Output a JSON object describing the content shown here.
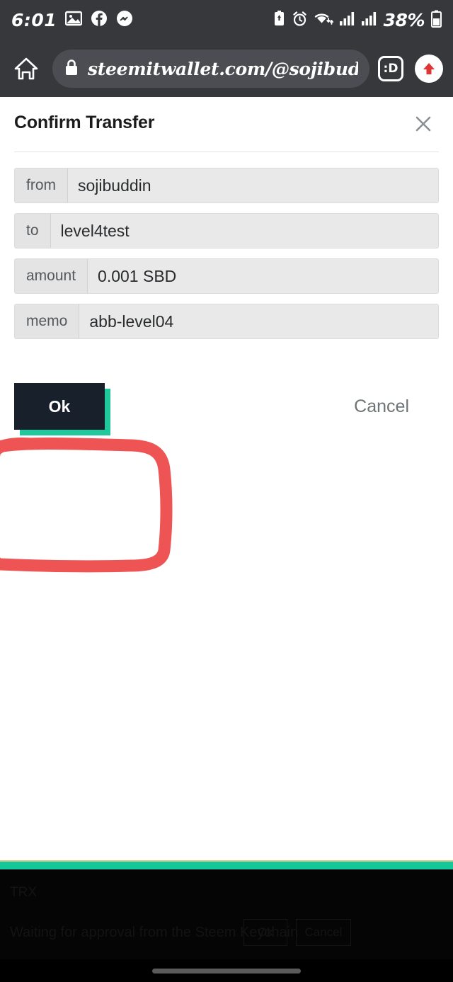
{
  "status_bar": {
    "time": "6:01",
    "battery_percent": "38%",
    "left_icons": [
      "photo-icon",
      "facebook-icon",
      "messenger-icon"
    ],
    "right_icons": [
      "battery-saver-icon",
      "alarm-icon",
      "wifi-icon",
      "signal-1-icon",
      "signal-2-icon",
      "battery-icon"
    ],
    "bar_color": "#36383c"
  },
  "browser": {
    "home_icon": "home-icon",
    "lock_icon": "lock-icon",
    "url": "steemitwallet.com/@sojibuddi",
    "tab_count_label": ":D",
    "menu_icon": "upload-arrow-icon",
    "bar_color": "#36383c"
  },
  "dialog": {
    "title": "Confirm Transfer",
    "close_icon": "close-icon",
    "fields": [
      {
        "label": "from",
        "value": "sojibuddin"
      },
      {
        "label": "to",
        "value": "level4test"
      },
      {
        "label": "amount",
        "value": "0.001 SBD"
      },
      {
        "label": "memo",
        "value": "abb-level04"
      }
    ],
    "ok_label": "Ok",
    "cancel_label": "Cancel",
    "ok_bg_color": "#17202b",
    "ok_shadow_color": "#1fc99b",
    "cancel_color": "#6e7376"
  },
  "annotation": {
    "shape": "hand-drawn-rectangle",
    "color": "#ef5454",
    "target": "ok-button"
  },
  "footer": {
    "accent_bar_color": "#16c79a",
    "label": "TRX",
    "message": "Waiting for approval from the Steem Keychain",
    "button_1": "Ok",
    "button_2": "Cancel"
  },
  "navigation": {
    "gesture_pill": "gesture-pill"
  }
}
